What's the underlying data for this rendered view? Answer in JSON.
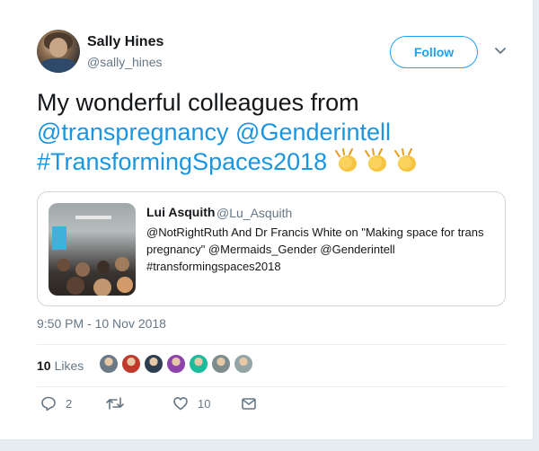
{
  "author": {
    "name": "Sally Hines",
    "handle": "@sally_hines"
  },
  "follow_label": "Follow",
  "tweet": {
    "line1": "My wonderful colleagues from",
    "mention1": "@transpregnancy",
    "mention2": "@Genderintell",
    "hashtag": "#TransformingSpaces2018",
    "emoji": "👏👏👏"
  },
  "quoted": {
    "name": "Lui Asquith",
    "handle": "@Lu_Asquith",
    "text": "@NotRightRuth And Dr Francis White on \"Making space for trans pregnancy\" @Mermaids_Gender @Genderintell #transformingspaces2018"
  },
  "timestamp": "9:50 PM - 10 Nov 2018",
  "likes": {
    "count": "10",
    "label": "Likes",
    "avatars": [
      "#6b7a86",
      "#c0392b",
      "#2c3e50",
      "#8e44ad",
      "#1abc9c",
      "#7f8c8d",
      "#95a5a6"
    ]
  },
  "actions": {
    "replies": "2",
    "retweets": "",
    "likes": "10"
  },
  "colors": {
    "accent": "#1da1f2",
    "link": "#1b95e0",
    "muted": "#657786"
  }
}
